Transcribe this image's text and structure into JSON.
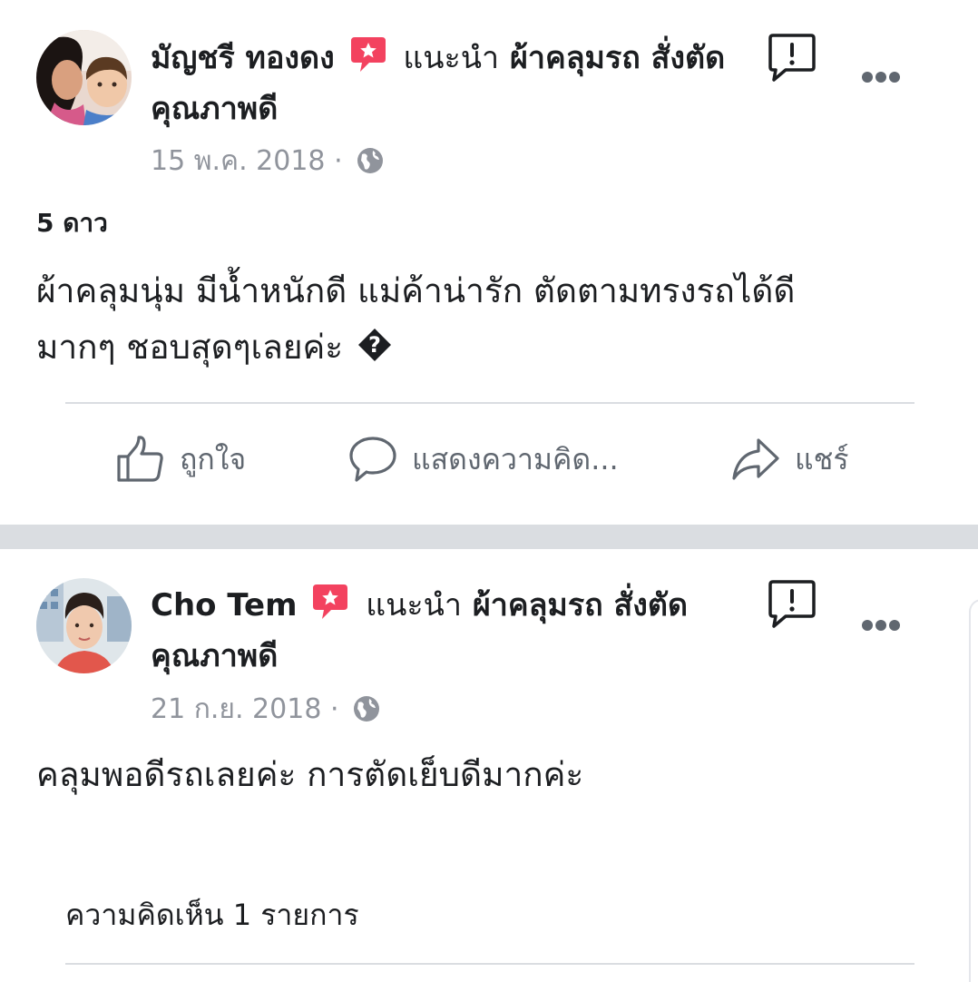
{
  "posts": [
    {
      "author": "มัญชรี ทองดง",
      "recommends": "แนะนำ",
      "page_name": "ผ้าคลุมรถ สั่งตัด คุณภาพดี",
      "date": "15 พ.ค. 2018",
      "separator": "·",
      "rating": "5 ดาว",
      "body_line1": "ผ้าคลุมนุ่ม มีน้ำหนักดี แม่ค้าน่ารัก ตัดตามทรงรถได้ดี",
      "body_line2": "มากๆ ชอบสุดๆเลยค่ะ",
      "body_glyph": "?",
      "actions": {
        "like": "ถูกใจ",
        "comment": "แสดงความคิด...",
        "share": "แชร์"
      }
    },
    {
      "author": "Cho Tem",
      "recommends": "แนะนำ",
      "page_name": "ผ้าคลุมรถ สั่งตัด คุณภาพดี",
      "date": "21 ก.ย. 2018",
      "separator": "·",
      "body_line1": "คลุมพอดีรถเลยค่ะ การตัดเย็บดีมากค่ะ",
      "comments_count": "ความคิดเห็น 1 รายการ"
    }
  ],
  "icons": {
    "recommend": "recommend-star-icon",
    "report": "report-exclamation-icon",
    "more": "more-dots-icon",
    "audience": "globe-icon",
    "like": "thumbs-up-icon",
    "comment": "comment-bubble-icon",
    "share": "share-arrow-icon"
  },
  "colors": {
    "recommend_badge": "#f3425f",
    "meta_text": "#90949c",
    "divider": "#dadde1",
    "action_text": "#606770"
  }
}
